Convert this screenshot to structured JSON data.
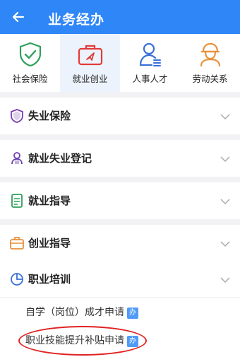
{
  "header": {
    "title": "业务经办",
    "back_icon": "arrow-left-icon"
  },
  "categories": [
    {
      "label": "社会保险",
      "icon": "shield-check-icon",
      "color": "#2ea05a"
    },
    {
      "label": "就业创业",
      "icon": "briefcase-icon",
      "color": "#e23b3b",
      "active": true
    },
    {
      "label": "人事人才",
      "icon": "person-card-icon",
      "color": "#3a6fd8"
    },
    {
      "label": "劳动关系",
      "icon": "worker-icon",
      "color": "#e8913a"
    }
  ],
  "sections": [
    {
      "label": "失业保险",
      "icon": "shield-icon"
    },
    {
      "label": "就业失业登记",
      "icon": "register-icon"
    },
    {
      "label": "就业指导",
      "icon": "document-icon"
    },
    {
      "label": "创业指导",
      "icon": "briefcase-small-icon"
    },
    {
      "label": "职业培训",
      "icon": "pie-chart-icon"
    }
  ],
  "training_items": [
    {
      "label": "自学（岗位）成才申请",
      "badge": "办"
    },
    {
      "label": "职业技能提升补贴申请",
      "badge": "办",
      "highlighted": true
    }
  ],
  "colors": {
    "primary": "#2f86f6",
    "highlight": "#e02222"
  }
}
